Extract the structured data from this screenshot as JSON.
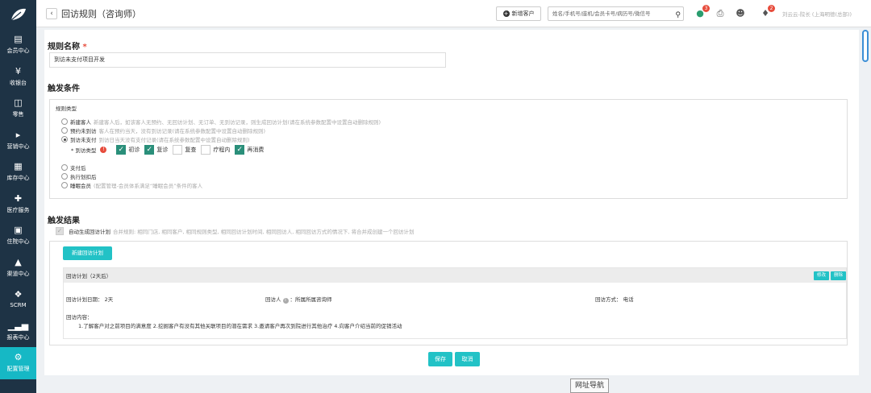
{
  "sidebar": {
    "items": [
      {
        "label": "会员中心",
        "icon": "gift-icon"
      },
      {
        "label": "收银台",
        "icon": "yen-icon"
      },
      {
        "label": "零售",
        "icon": "cart-icon"
      },
      {
        "label": "营销中心",
        "icon": "megaphone-icon"
      },
      {
        "label": "库存中心",
        "icon": "grid-icon"
      },
      {
        "label": "医疗服务",
        "icon": "medical-kit-icon"
      },
      {
        "label": "住院中心",
        "icon": "clipboard-icon"
      },
      {
        "label": "渠道中心",
        "icon": "sitemap-icon"
      },
      {
        "label": "SCRM",
        "icon": "cubes-icon"
      },
      {
        "label": "报表中心",
        "icon": "bar-chart-icon"
      },
      {
        "label": "配置管理",
        "icon": "gear-icon",
        "active": true
      }
    ]
  },
  "header": {
    "back": "‹",
    "title": "回访规则（咨询师）",
    "add_customer": "新增客户",
    "search_placeholder": "姓名/手机号/座机/会员卡号/病历号/微信号",
    "chat_badge": "3",
    "bell_badge": "2",
    "user": "刘云云-院长 (上海明德(总部))"
  },
  "rule_name": {
    "title": "规则名称",
    "required_mark": "*",
    "value": "到访未支付项目开发"
  },
  "trigger": {
    "title": "触发条件",
    "type_label": "规则类型",
    "options": [
      {
        "label": "新建客人",
        "desc": "新建客人后，如该客人无预约、无回访计划、无订单、无到访记录，则生成回访计划(请在系统参数配置中设置自动删除规则)"
      },
      {
        "label": "预约未到访",
        "desc": "客人在预约当天，没有到访记录(请在系统参数配置中设置自动删除规则)"
      },
      {
        "label": "到访未支付",
        "desc": "到访日当天没有支付记录(请在系统参数配置中设置自动删除规则)",
        "checked": true
      },
      {
        "label": "支付后",
        "desc": ""
      },
      {
        "label": "执行划扣后",
        "desc": ""
      },
      {
        "label": "睡眠会员",
        "desc": "(配置管理-会员体系满足“睡眠会员”条件的客人"
      }
    ],
    "visit_type_label": "到访类型",
    "visit_types": [
      {
        "label": "初诊",
        "checked": true
      },
      {
        "label": "复诊",
        "checked": true
      },
      {
        "label": "复查",
        "checked": false
      },
      {
        "label": "疗程内",
        "checked": false
      },
      {
        "label": "再消费",
        "checked": true
      }
    ]
  },
  "result": {
    "title": "触发结果",
    "auto_label": "自动生成回访计划",
    "auto_desc": "合并规则: 相同门店, 相同客户, 相同规则类型, 相同回访计划时间, 相同回访人, 相同回访方式的情况下, 将合并成创建一个回访计划",
    "new_plan_button": "新建回访计划",
    "plan": {
      "header": "回访计划（2天后）",
      "edit": "修改",
      "delete": "删除",
      "date_label": "回访计划日期：",
      "date_value": "2天",
      "visitor_label": "回访人",
      "visitor_value": "：所属所属咨询师",
      "method_label": "回访方式：",
      "method_value": "电话",
      "content_label": "回访内容：",
      "content_value": "1.了解客户对之前项目的满意度 2.挖掘客户有没有其他关联项目的潜在需求 3.邀请客户再次到院进行其他治疗 4.向客户介绍当前的促销活动"
    }
  },
  "actions": {
    "save": "保存",
    "cancel": "取消"
  },
  "url_nav": "网址导航"
}
